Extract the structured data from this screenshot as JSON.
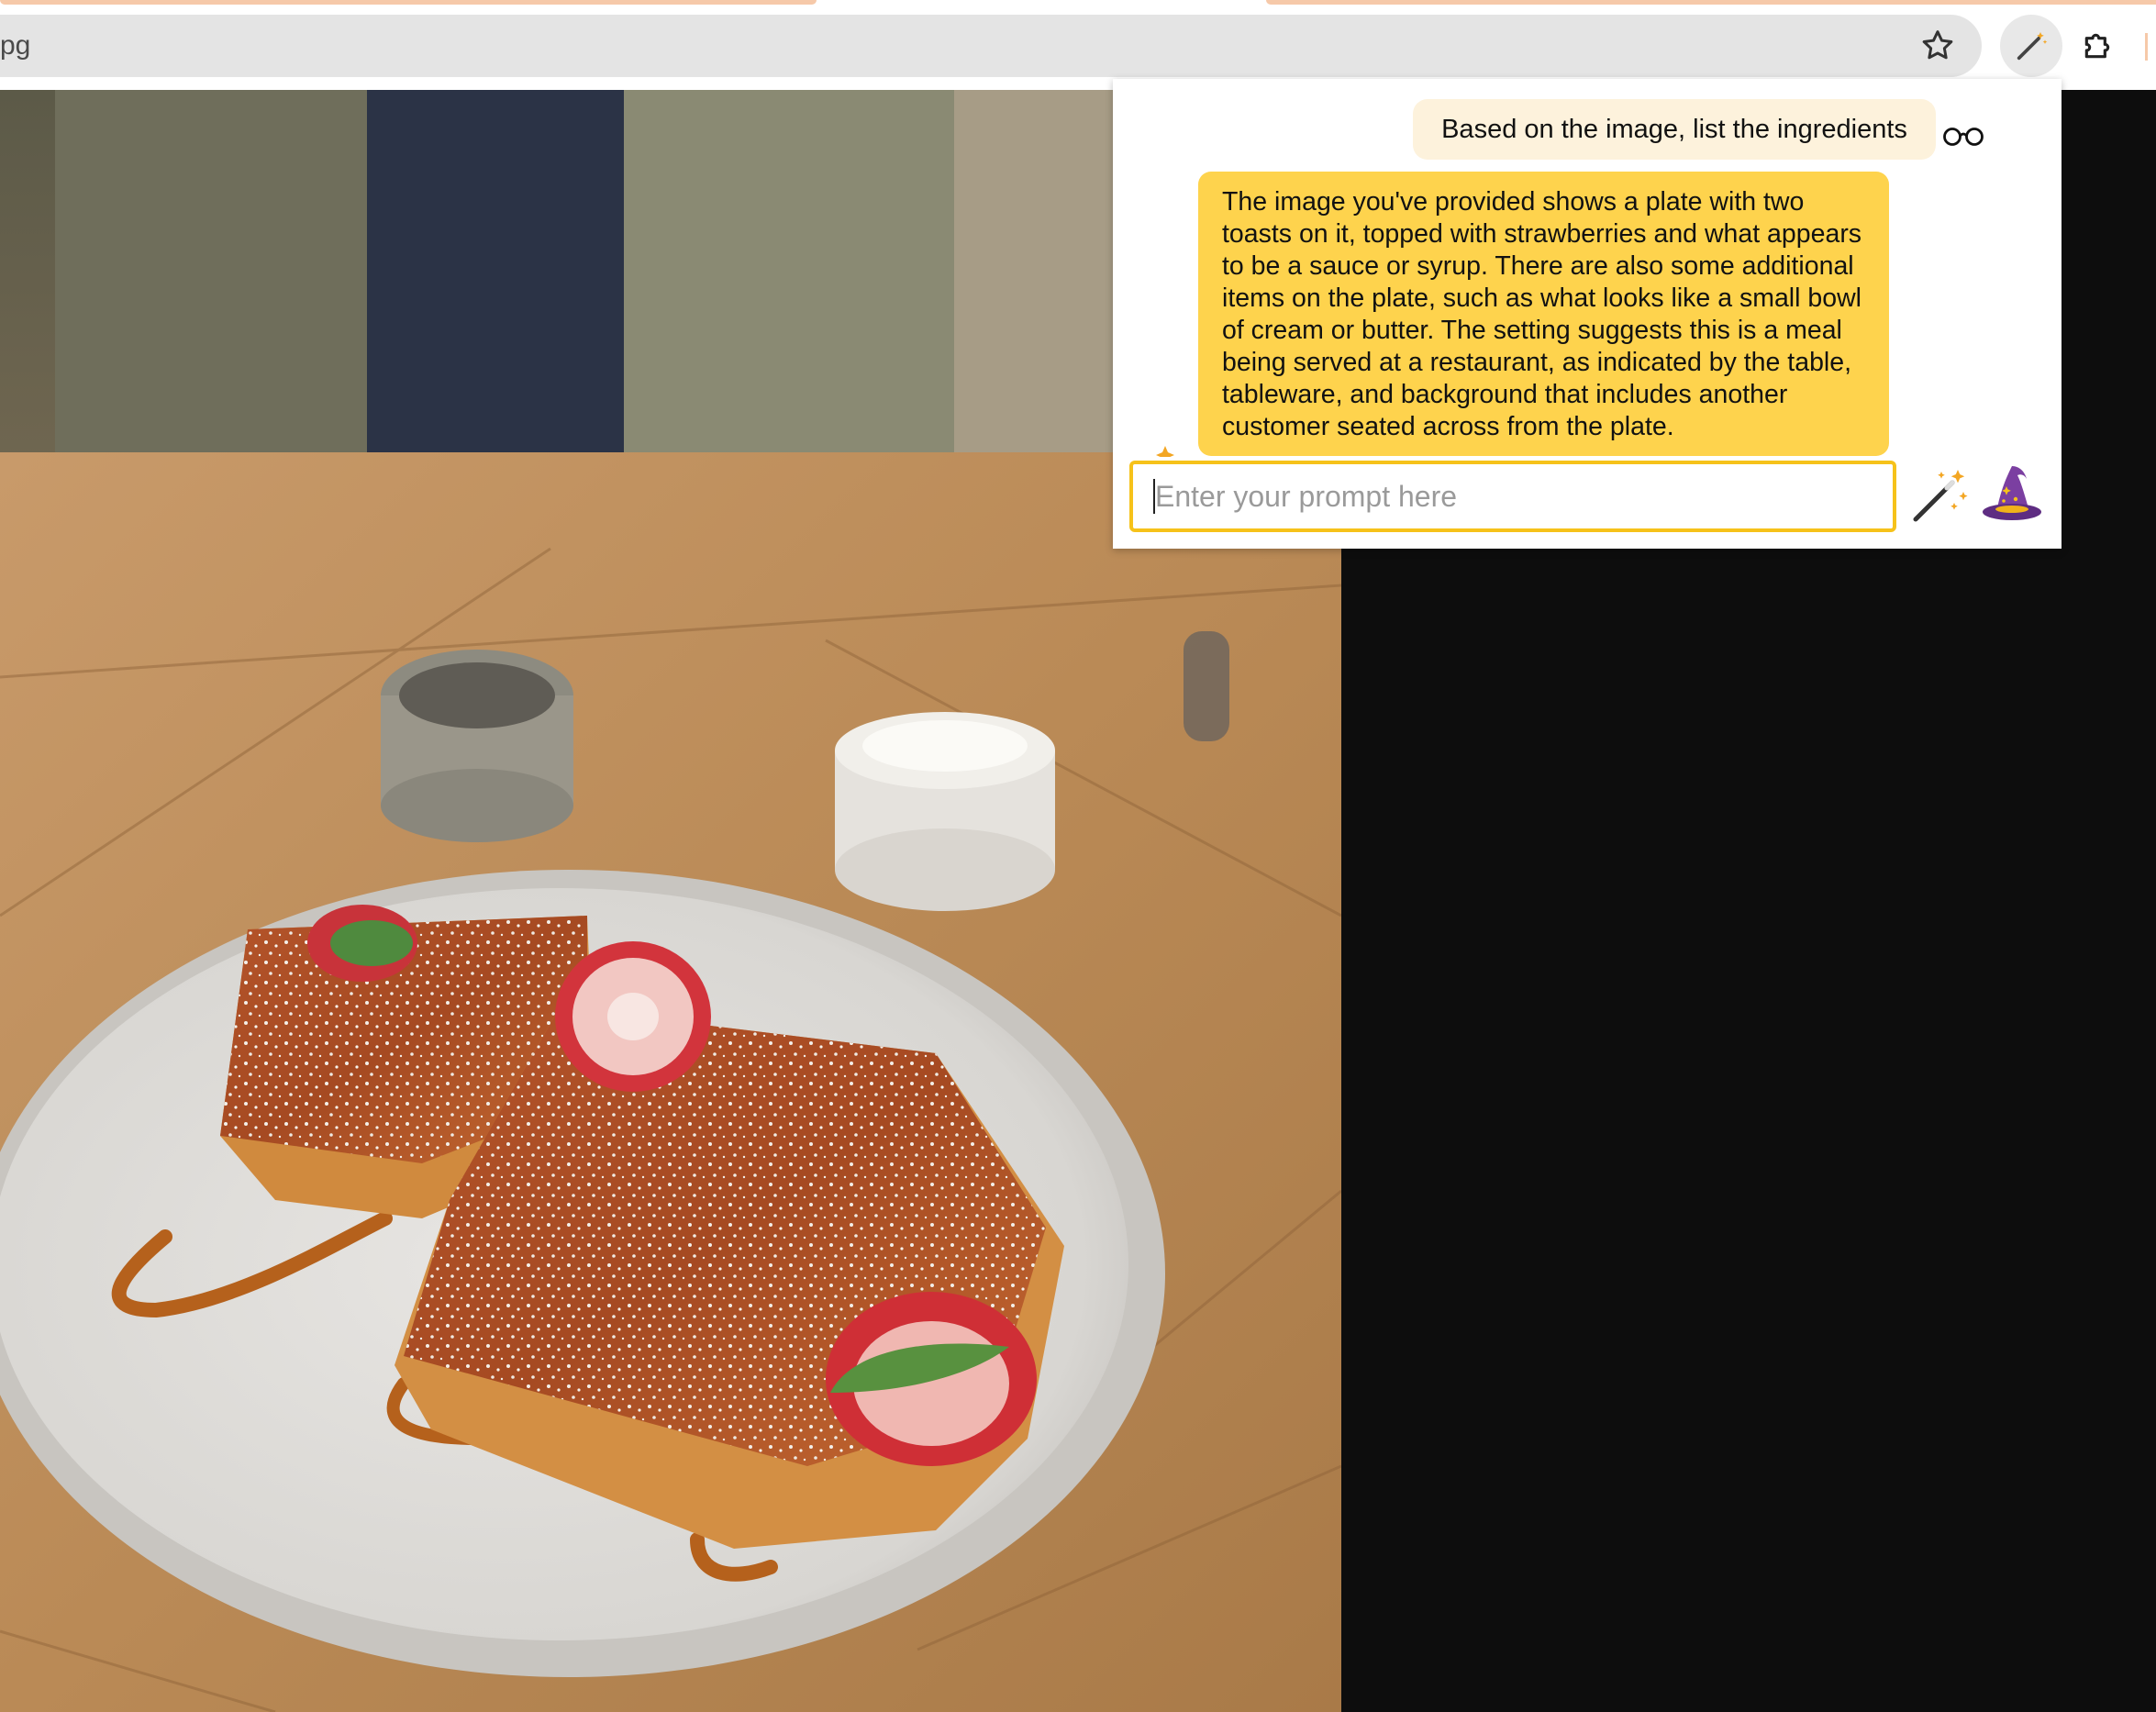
{
  "browser": {
    "url_fragment": "pg",
    "icons": {
      "bookmark": "star-icon",
      "extension_active": "magic-wand-icon",
      "extensions_menu": "puzzle-icon"
    }
  },
  "viewer": {
    "image_description": "photo-of-french-toast-plate"
  },
  "popup": {
    "user_message": "Based on the image, list the ingredients",
    "user_avatar_icon": "glasses-icon",
    "assistant_message": "The image you've provided shows a plate with two toasts on it, topped with strawberries and what appears to be a sauce or syrup. There are also some additional items on the plate, such as what looks like a small bowl of cream or butter. The setting suggests this is a meal being served at a restaurant, as indicated by the table, tableware, and background that includes another customer seated across from the plate.",
    "input_placeholder": "Enter your prompt here",
    "input_value": "",
    "buttons": {
      "submit_icon": "magic-wand-icon",
      "wizard_icon": "wizard-hat-icon"
    },
    "colors": {
      "assistant_bubble": "#fed34d",
      "user_bubble": "#fdf2dc",
      "input_border": "#f6c21a"
    }
  }
}
